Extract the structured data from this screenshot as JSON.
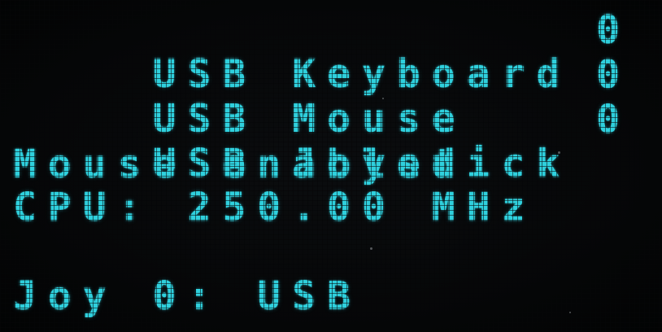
{
  "usb_devices": [
    {
      "label": "USB Keyboard",
      "count": "0"
    },
    {
      "label": "USB Mouse",
      "count": "0"
    },
    {
      "label": "USB Joystick",
      "count": "0"
    }
  ],
  "mouse_status": "Mouse enabled",
  "cpu": "CPU: 250.00 MHz",
  "joy_line": "Joy 0: USB",
  "colors": {
    "text": "#2fd0dd",
    "background": "#050607"
  }
}
